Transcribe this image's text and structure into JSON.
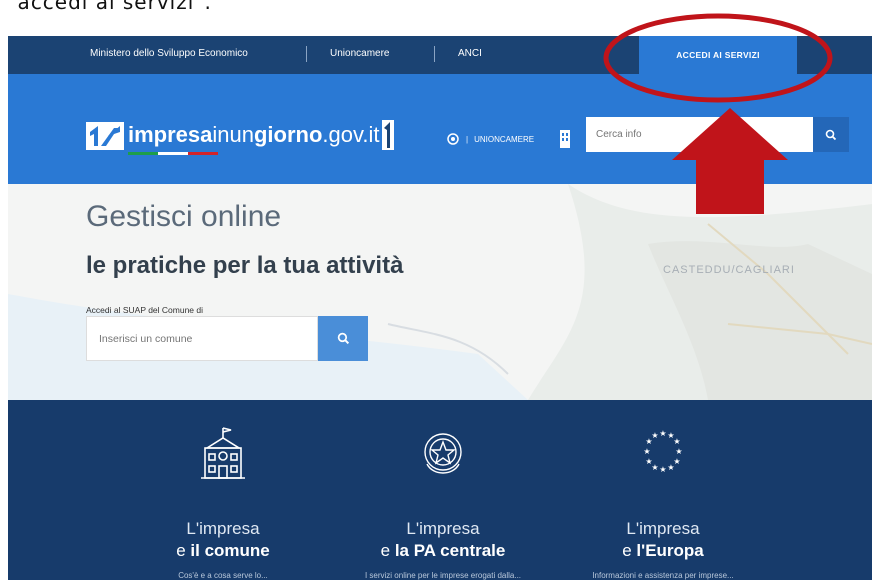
{
  "caption": "\" accedi ai servizi\".",
  "topbar": {
    "links": [
      "Ministero dello Sviluppo Economico",
      "Unioncamere",
      "ANCI"
    ],
    "access_button": "ACCEDI AI SERVIZI"
  },
  "header": {
    "logo_brand_bold": "impresa",
    "logo_brand_mid": "inun",
    "logo_brand_bold2": "giorno",
    "logo_brand_tail": ".gov.it",
    "partner_unioncamere": "UNIONCAMERE",
    "search_placeholder": "Cerca info"
  },
  "hero": {
    "title": "Gestisci online",
    "subtitle": "le pratiche per la tua attività",
    "suap_label": "Accedi al SUAP del Comune di",
    "comune_placeholder": "Inserisci un comune",
    "map_city": "CASTEDDU/CAGLIARI"
  },
  "columns": [
    {
      "line1": "L'impresa",
      "line2_pre": "e ",
      "line2_bold": "il comune",
      "desc": "Cos'è e a cosa serve lo..."
    },
    {
      "line1": "L'impresa",
      "line2_pre": "e ",
      "line2_bold": "la PA centrale",
      "desc": "I servizi online per le imprese erogati dalla..."
    },
    {
      "line1": "L'impresa",
      "line2_pre": "e ",
      "line2_bold": "l'Europa",
      "desc": "Informazioni e assistenza per imprese..."
    }
  ],
  "colors": {
    "topbar": "#1b4373",
    "header": "#2a79d4",
    "bottom": "#173b6b",
    "annotation": "#c0141a"
  },
  "icons": [
    "search-icon",
    "school-building-icon",
    "italian-emblem-icon",
    "eu-stars-icon"
  ]
}
